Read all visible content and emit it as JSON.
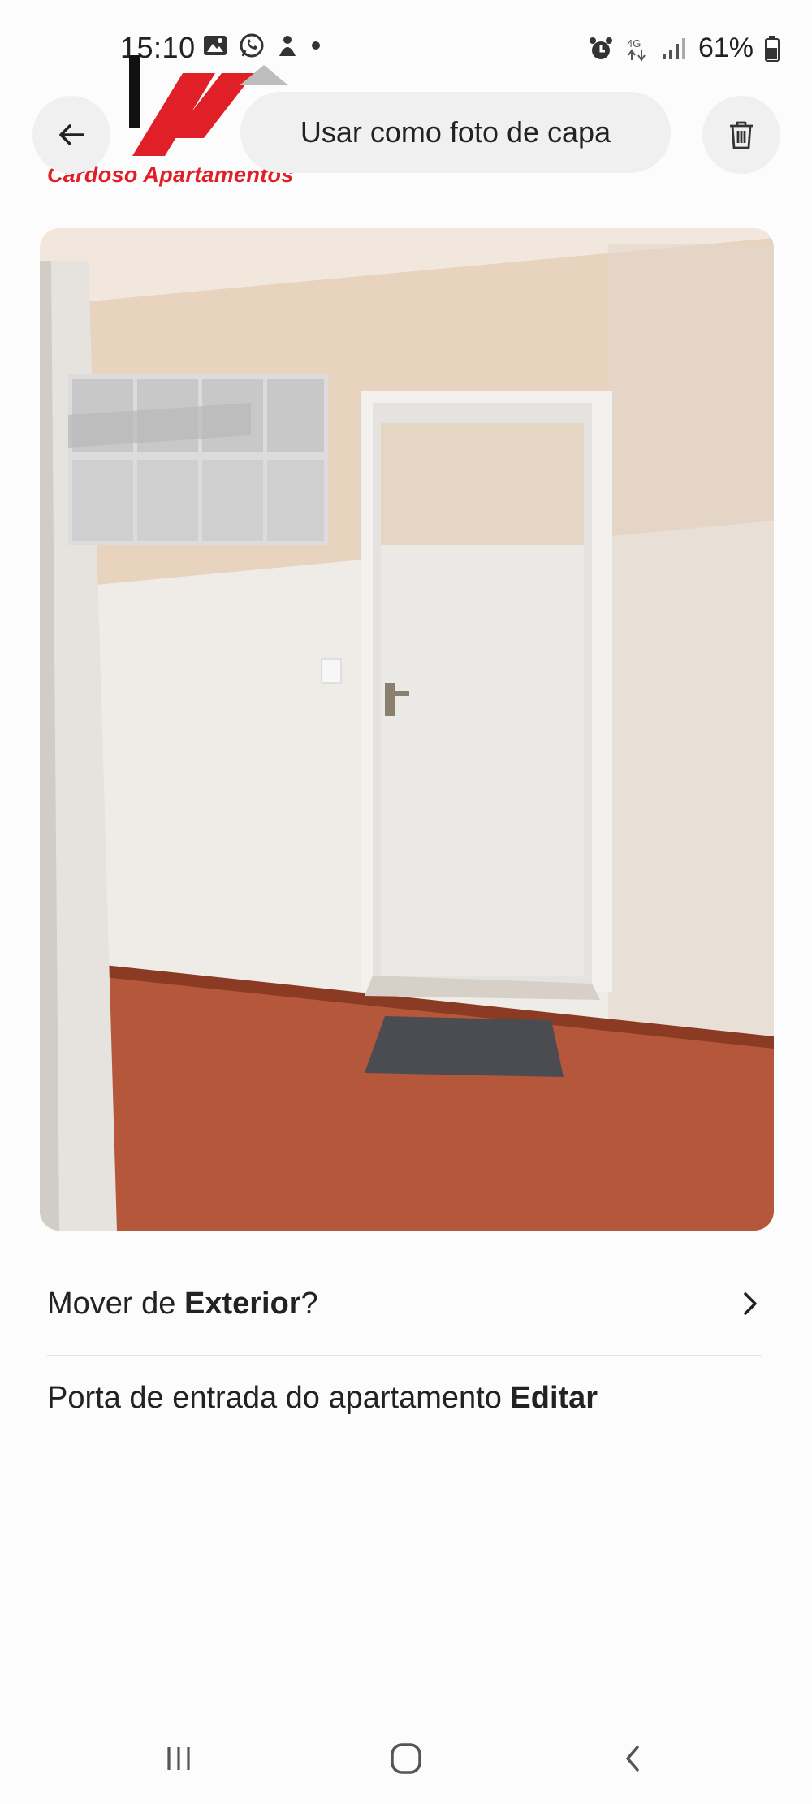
{
  "status_bar": {
    "time": "15:10",
    "battery": "61%",
    "left_icons": [
      "gallery-icon",
      "whatsapp-icon",
      "app-notification-icon",
      "dot-icon"
    ],
    "right_icons": [
      "alarm-icon",
      "4g-icon",
      "signal-icon",
      "battery-icon"
    ]
  },
  "watermark": {
    "text": "Cardoso Apartamentos",
    "color": "#e01f26"
  },
  "header": {
    "back_icon": "arrow-left-icon",
    "cover_button_label": "Usar como foto de capa",
    "delete_icon": "trash-icon"
  },
  "photo": {
    "description_alt": "Porta de entrada do apartamento"
  },
  "move_row": {
    "prefix": "Mover de ",
    "category": "Exterior",
    "suffix": "?",
    "icon": "chevron-right-icon"
  },
  "caption_row": {
    "caption": "Porta de entrada do apartamento",
    "edit_label": "Editar"
  },
  "nav_bar": {
    "items": [
      "recents-icon",
      "home-icon",
      "back-icon"
    ]
  }
}
